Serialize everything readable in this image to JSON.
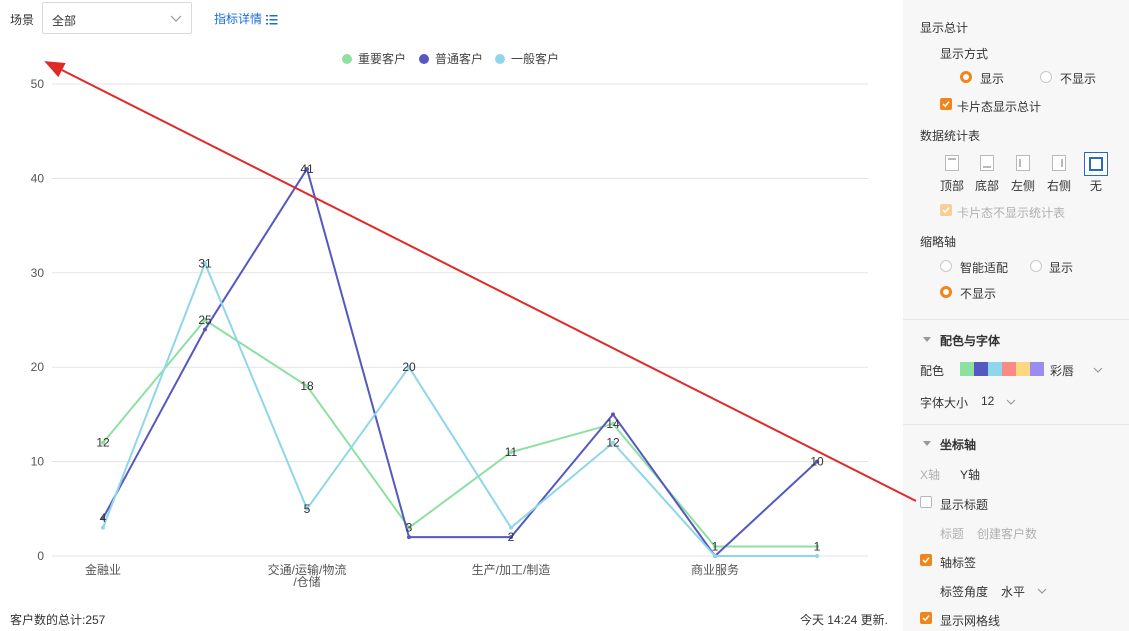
{
  "toolbar": {
    "scene_label": "场景",
    "scene_value": "全部",
    "detail_link": "指标详情"
  },
  "footer": {
    "total": "客户数的总计:257",
    "updated": "今天 14:24 更新."
  },
  "chart_data": {
    "type": "line",
    "categories": [
      "金融业",
      "",
      "交通/运输/物流/仓储",
      "",
      "生产/加工/制造",
      "",
      "商业服务",
      ""
    ],
    "x_tick_labels": [
      {
        "index": 0,
        "lines": [
          "金融业"
        ]
      },
      {
        "index": 2,
        "lines": [
          "交通/运输/物流",
          "/仓储"
        ]
      },
      {
        "index": 4,
        "lines": [
          "生产/加工/制造"
        ]
      },
      {
        "index": 6,
        "lines": [
          "商业服务"
        ]
      }
    ],
    "series": [
      {
        "name": "重要客户",
        "color": "#8ee0a2",
        "values": [
          12,
          25,
          18,
          3,
          11,
          14,
          1,
          1
        ]
      },
      {
        "name": "普通客户",
        "color": "#5558c0",
        "values": [
          4,
          24,
          41,
          2,
          2,
          15,
          0,
          10
        ]
      },
      {
        "name": "一般客户",
        "color": "#8fd6ea",
        "values": [
          3,
          31,
          5,
          20,
          3,
          12,
          0,
          0
        ]
      }
    ],
    "data_labels": [
      {
        "v": 12,
        "i": 0,
        "s": 0
      },
      {
        "v": 25,
        "i": 1,
        "s": 0
      },
      {
        "v": 18,
        "i": 2,
        "s": 0
      },
      {
        "v": 3,
        "i": 3,
        "s": 0
      },
      {
        "v": 11,
        "i": 4,
        "s": 0
      },
      {
        "v": 14,
        "i": 5,
        "s": 0
      },
      {
        "v": 1,
        "i": 6,
        "s": 0
      },
      {
        "v": 1,
        "i": 7,
        "s": 0
      },
      {
        "v": 4,
        "i": 0,
        "s": 1
      },
      {
        "v": 41,
        "i": 2,
        "s": 1
      },
      {
        "v": 2,
        "i": 4,
        "s": 1
      },
      {
        "v": 10,
        "i": 7,
        "s": 1
      },
      {
        "v": 31,
        "i": 1,
        "s": 2
      },
      {
        "v": 5,
        "i": 2,
        "s": 2
      },
      {
        "v": 20,
        "i": 3,
        "s": 2
      },
      {
        "v": 12,
        "i": 5,
        "s": 2
      }
    ],
    "yticks": [
      0,
      10,
      20,
      30,
      40,
      50
    ],
    "ylim": [
      0,
      50
    ],
    "grid": true,
    "legend_position": "top-center",
    "annotation": {
      "type": "red-arrow",
      "color": "#e02a2a",
      "from": "show-title-checkbox",
      "to": "chart-top-left"
    }
  },
  "panel": {
    "show_total": "显示总计",
    "display_mode": "显示方式",
    "opt_show": "显示",
    "opt_hide": "不显示",
    "card_show_total": "卡片态显示总计",
    "data_table": "数据统计表",
    "pos_top": "顶部",
    "pos_bottom": "底部",
    "pos_left": "左侧",
    "pos_right": "右侧",
    "pos_none": "无",
    "card_no_table": "卡片态不显示统计表",
    "thumb_axis": "缩略轴",
    "opt_smart": "智能适配",
    "opt_show2": "显示",
    "opt_hide2": "不显示",
    "color_font": "配色与字体",
    "color_label": "配色",
    "palette_name": "彩唇",
    "palette": [
      "#8ee0a2",
      "#5558c0",
      "#8fd6ea",
      "#f98b85",
      "#fdd882",
      "#9b8df0"
    ],
    "font_size_label": "字体大小",
    "font_size_value": "12",
    "axis_section": "坐标轴",
    "x_axis": "X轴",
    "y_axis": "Y轴",
    "show_title": "显示标题",
    "title_label": "标题",
    "title_value": "创建客户数",
    "axis_tick": "轴标签",
    "tick_angle": "标签角度",
    "tick_angle_value": "水平",
    "show_grid": "显示网格线"
  }
}
